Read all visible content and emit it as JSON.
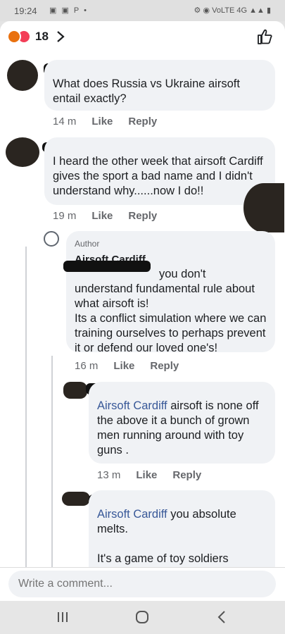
{
  "status_bar": {
    "time": "19:24",
    "left_icons": "▣ ▣ P •",
    "right_icons": "⚙ ◉ VoLTE 4G ▲▲ ▮"
  },
  "header": {
    "reaction_count": "18",
    "reaction_icons": [
      "angry-icon",
      "love-icon"
    ]
  },
  "comments": [
    {
      "text": "What does Russia vs Ukraine airsoft entail exactly?",
      "time": "14 m",
      "like": "Like",
      "reply": "Reply"
    },
    {
      "text": "I heard the other week that airsoft Cardiff gives the sport a bad name and I didn't understand why......now I do!!",
      "time": "19 m",
      "like": "Like",
      "reply": "Reply"
    },
    {
      "author_tag": "Author",
      "author_name": "Airsoft Cardiff",
      "text": "you don't understand fundamental rule about what airsoft is!\nIts a conflict simulation where we can training ourselves to perhaps prevent it or defend our loved one's!",
      "time": "16 m",
      "like": "Like",
      "reply": "Reply"
    },
    {
      "mention": "Airsoft Cardiff",
      "text": " airsoft is none off the above it a bunch of grown men running around with toy guns .",
      "time": "13 m",
      "like": "Like",
      "reply": "Reply"
    },
    {
      "mention": "Airsoft Cardiff",
      "text": " you absolute melts.\n\nIt's a game of toy soldiers"
    }
  ],
  "composer": {
    "placeholder": "Write a comment..."
  },
  "colors": {
    "mention": "#385898",
    "bubble": "#f0f2f5",
    "meta": "#65676b"
  }
}
